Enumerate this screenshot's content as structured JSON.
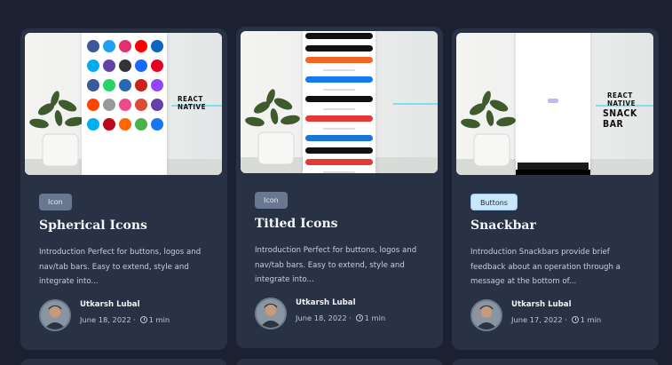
{
  "cards": [
    {
      "tag": "Icon",
      "title": "Spherical Icons",
      "description": "Introduction Perfect for buttons, logos and nav/tab bars. Easy to extend, style and integrate into...",
      "author": "Utkarsh Lubal",
      "date": "June 18, 2022",
      "read_time": "1 min",
      "thumb_title": "REACT NATIVE"
    },
    {
      "tag": "Icon",
      "title": "Titled Icons",
      "description": "Introduction Perfect for buttons, logos and nav/tab bars. Easy to extend, style and integrate into...",
      "author": "Utkarsh Lubal",
      "date": "June 18, 2022",
      "read_time": "1 min"
    },
    {
      "tag": "Buttons",
      "title": "Snackbar",
      "description": "Introduction Snackbars provide brief feedback about an operation through a message at the bottom of...",
      "author": "Utkarsh Lubal",
      "date": "June 17, 2022",
      "read_time": "1 min",
      "thumb_title_1": "REACT NATIVE",
      "thumb_title_2": "SNACK BAR"
    }
  ],
  "separator": "·",
  "colors": {
    "background": "#1b2130",
    "card": "#283244",
    "tag": "#6a7791",
    "tag_light": "#c9e6fb"
  }
}
